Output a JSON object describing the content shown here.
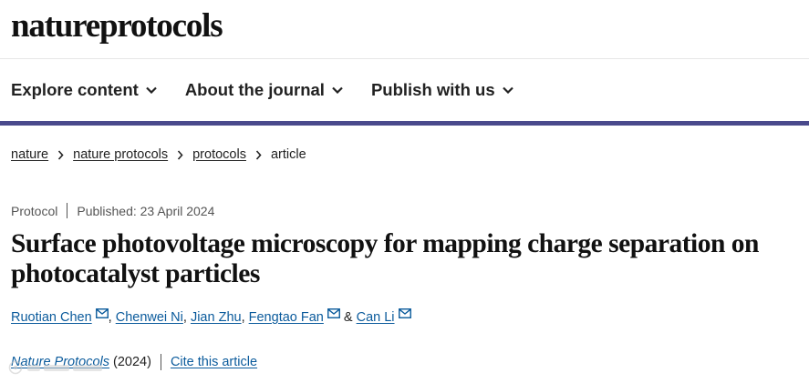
{
  "header": {
    "logo_text": "natureprotocols"
  },
  "nav": {
    "items": [
      {
        "label": "Explore content"
      },
      {
        "label": "About the journal"
      },
      {
        "label": "Publish with us"
      }
    ]
  },
  "breadcrumb": {
    "items": [
      "nature",
      "nature protocols",
      "protocols"
    ],
    "current": "article"
  },
  "article": {
    "type": "Protocol",
    "published": "Published: 23 April 2024",
    "title": "Surface photovoltage microscopy for mapping charge separation on photocatalyst particles",
    "authors": [
      {
        "name": "Ruotian Chen",
        "email_icon": true,
        "sep": ", "
      },
      {
        "name": "Chenwei Ni",
        "email_icon": false,
        "sep": ", "
      },
      {
        "name": "Jian Zhu",
        "email_icon": false,
        "sep": ", "
      },
      {
        "name": "Fengtao Fan",
        "email_icon": true,
        "sep": " & "
      },
      {
        "name": "Can Li",
        "email_icon": true,
        "sep": ""
      }
    ],
    "journal": "Nature Protocols",
    "year": "(2024)",
    "cite_label": "Cite this article"
  },
  "icons": {
    "chevron": "chevron-down-icon",
    "crumb_separator": "chevron-right-icon",
    "email": "envelope-icon"
  },
  "colors": {
    "nav_rule": "#4a4a8c",
    "link": "#0b5b9c",
    "text": "#222222"
  }
}
